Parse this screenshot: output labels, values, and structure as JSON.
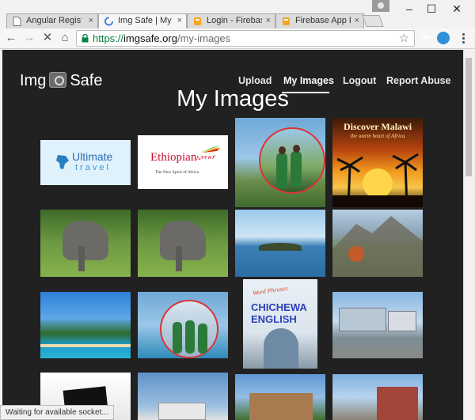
{
  "tabs": [
    {
      "title": "Angular Registrati",
      "close": "×",
      "favicon": "page-icon"
    },
    {
      "title": "Img Safe | My Ima",
      "close": "×",
      "favicon": "loading-spinner-icon"
    },
    {
      "title": "Login - Firebase",
      "close": "×",
      "favicon": "firebase-icon"
    },
    {
      "title": "Firebase App Das",
      "close": "×",
      "favicon": "firebase-icon"
    }
  ],
  "window_controls": {
    "minimize": "–",
    "maximize": "☐",
    "close": "✕"
  },
  "nav_buttons": {
    "back": "←",
    "forward": "→",
    "stop": "✕",
    "home": "⌂"
  },
  "address": {
    "scheme": "https://",
    "host": "imgsafe.org",
    "path": "/my-images",
    "star": "☆"
  },
  "extensions": [
    {
      "label": "ABP",
      "color": "#cc1f1f"
    },
    {
      "label": "",
      "color": "#2f8fd8"
    }
  ],
  "site": {
    "brand_left": "Img",
    "brand_right": "Safe",
    "nav": [
      "Upload",
      "My Images",
      "Logout",
      "Report Abuse"
    ],
    "active_nav": "My Images",
    "title": "My Images"
  },
  "images": {
    "ultimate": {
      "word1": "Ultimate",
      "word2": "travel"
    },
    "ethiopian": {
      "name": "Ethiopian",
      "script": "ኢትዮጵያ",
      "tagline": "The New Spirit of Africa"
    },
    "malawi": {
      "title": "Discover Malawi",
      "subtitle": "the warm heart of Africa"
    },
    "chichewa": {
      "top": "Word Phrases",
      "line1": "CHICHEWA",
      "line2": "ENGLISH"
    }
  },
  "status": "Waiting for available socket..."
}
